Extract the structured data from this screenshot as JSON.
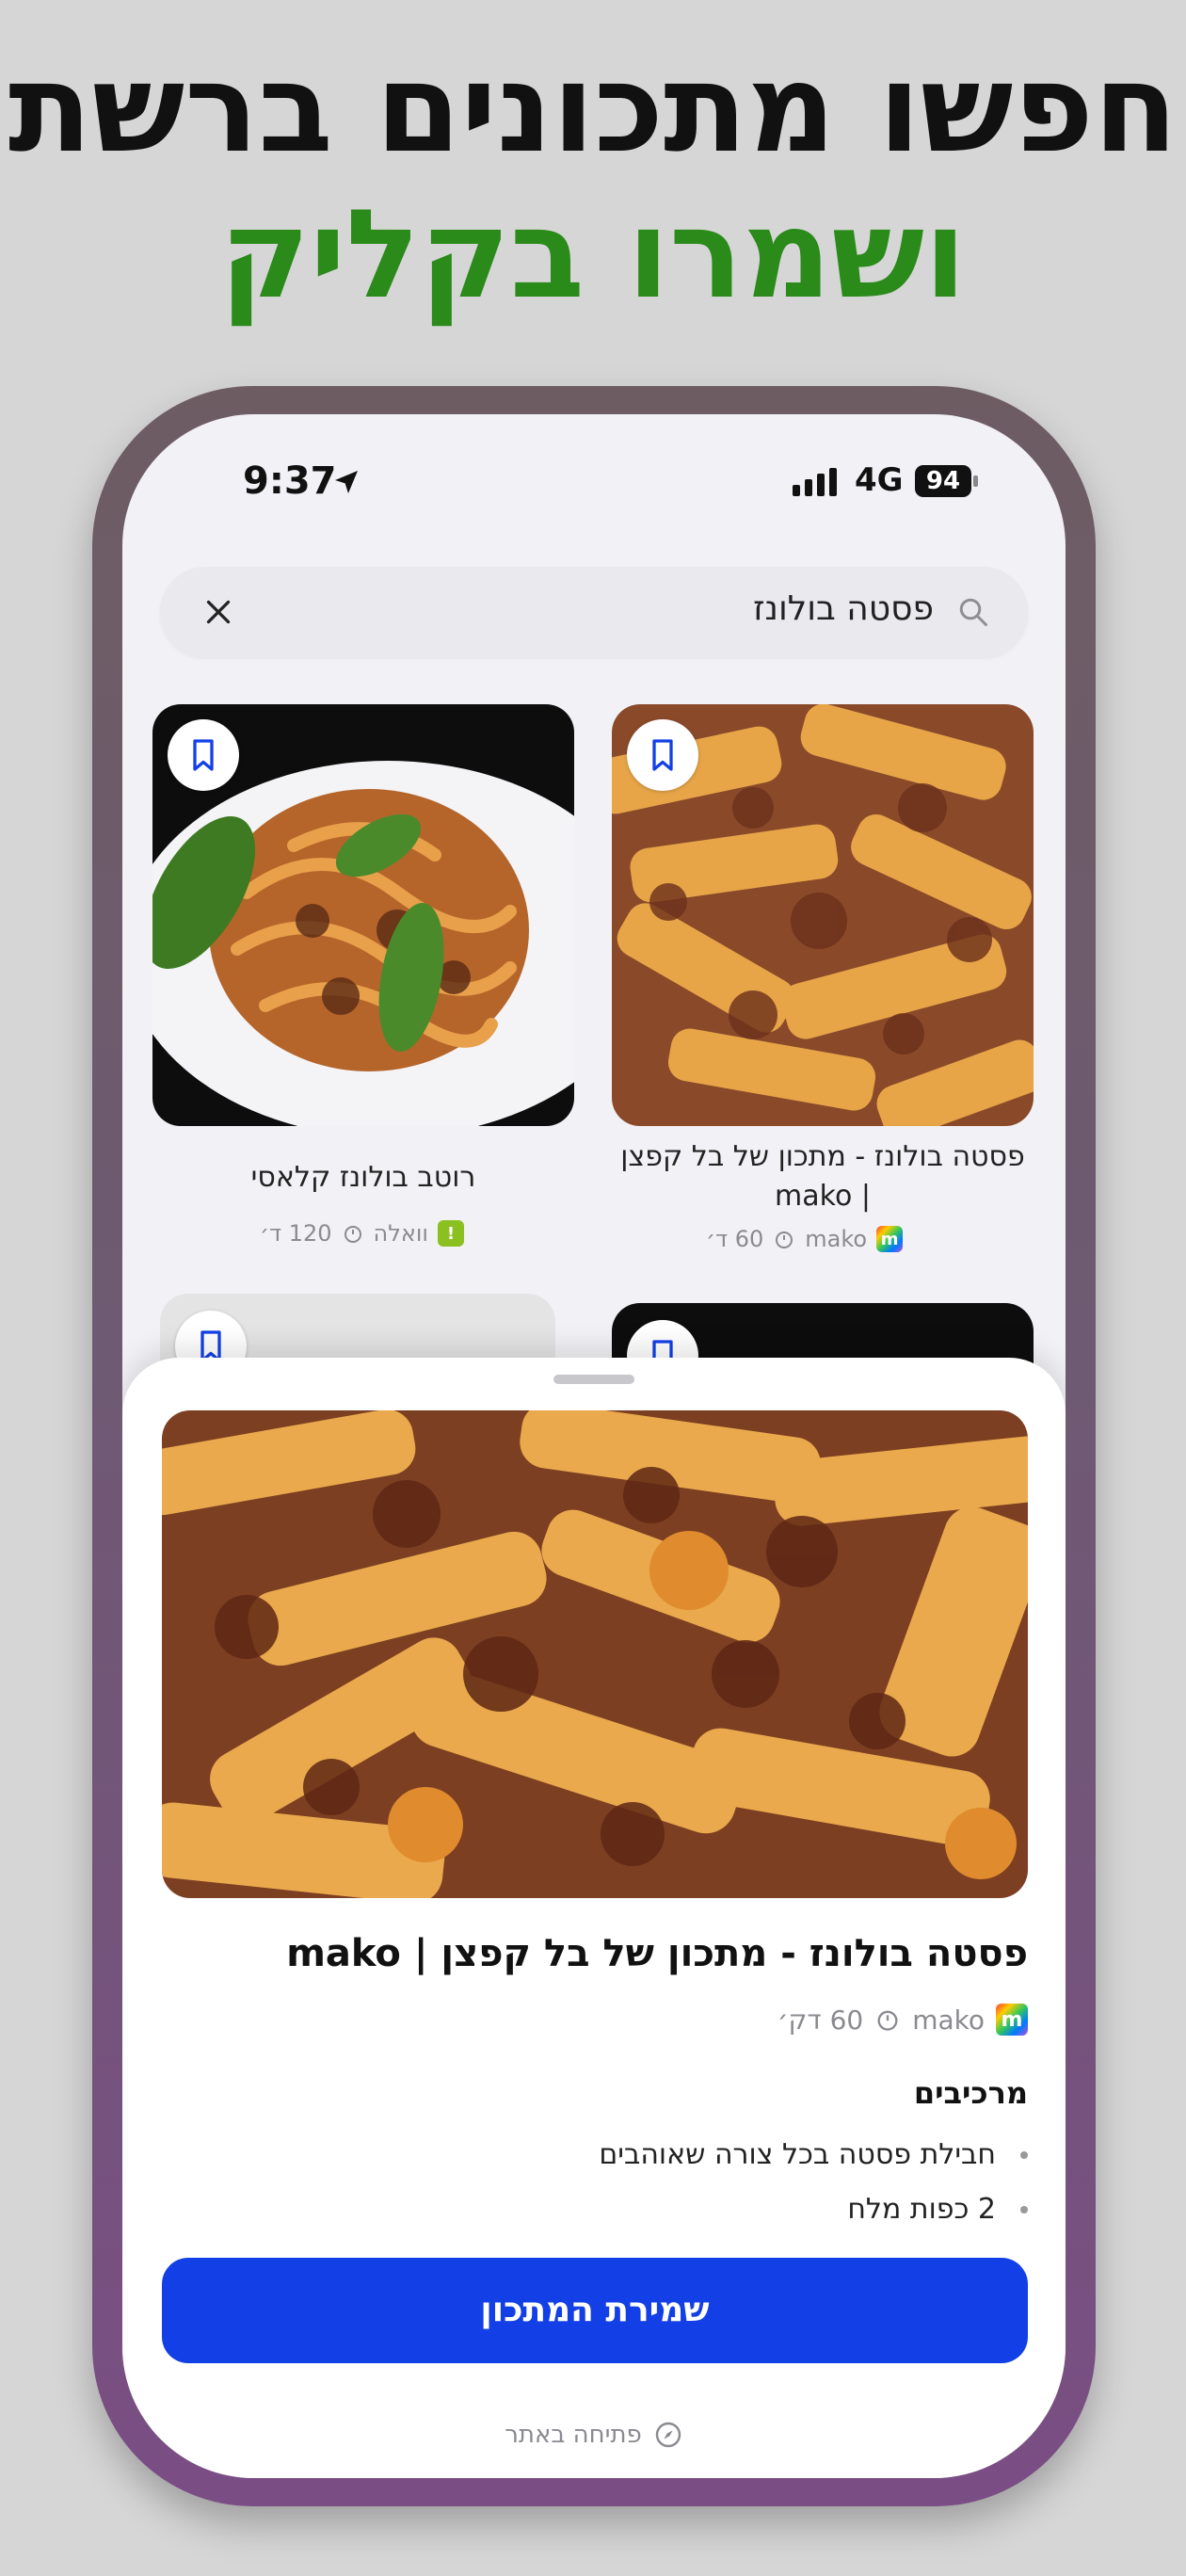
{
  "headline": {
    "line1": "חפשו מתכונים ברשת",
    "line2": "ושמרו בקליק"
  },
  "status_bar": {
    "time": "9:37",
    "network": "4G",
    "battery": "94"
  },
  "search": {
    "query": "פסטה בולונז"
  },
  "results": [
    {
      "title": "פסטה בולונז - מתכון של בל קפצן | mako",
      "source": "mako",
      "time": "60 ד׳",
      "icon": "bookmark-icon"
    },
    {
      "title": "רוטב בולונז קלאסי",
      "source": "וואלה",
      "time": "120 ד׳",
      "icon": "bookmark-icon"
    }
  ],
  "sheet": {
    "title": "פסטה בולונז - מתכון של בל קפצן | mako",
    "source": "mako",
    "time": "60 דק׳",
    "ingredients_heading": "מרכיבים",
    "ingredients": [
      "חבילת פסטה בכל צורה שאוהבים",
      "2 כפות מלח"
    ],
    "save_label": "שמירת המתכון",
    "open_label": "פתיחה באתר"
  },
  "colors": {
    "accent": "#1340e6",
    "headline_green": "#2a8a1a",
    "walla": "#8ac121"
  }
}
